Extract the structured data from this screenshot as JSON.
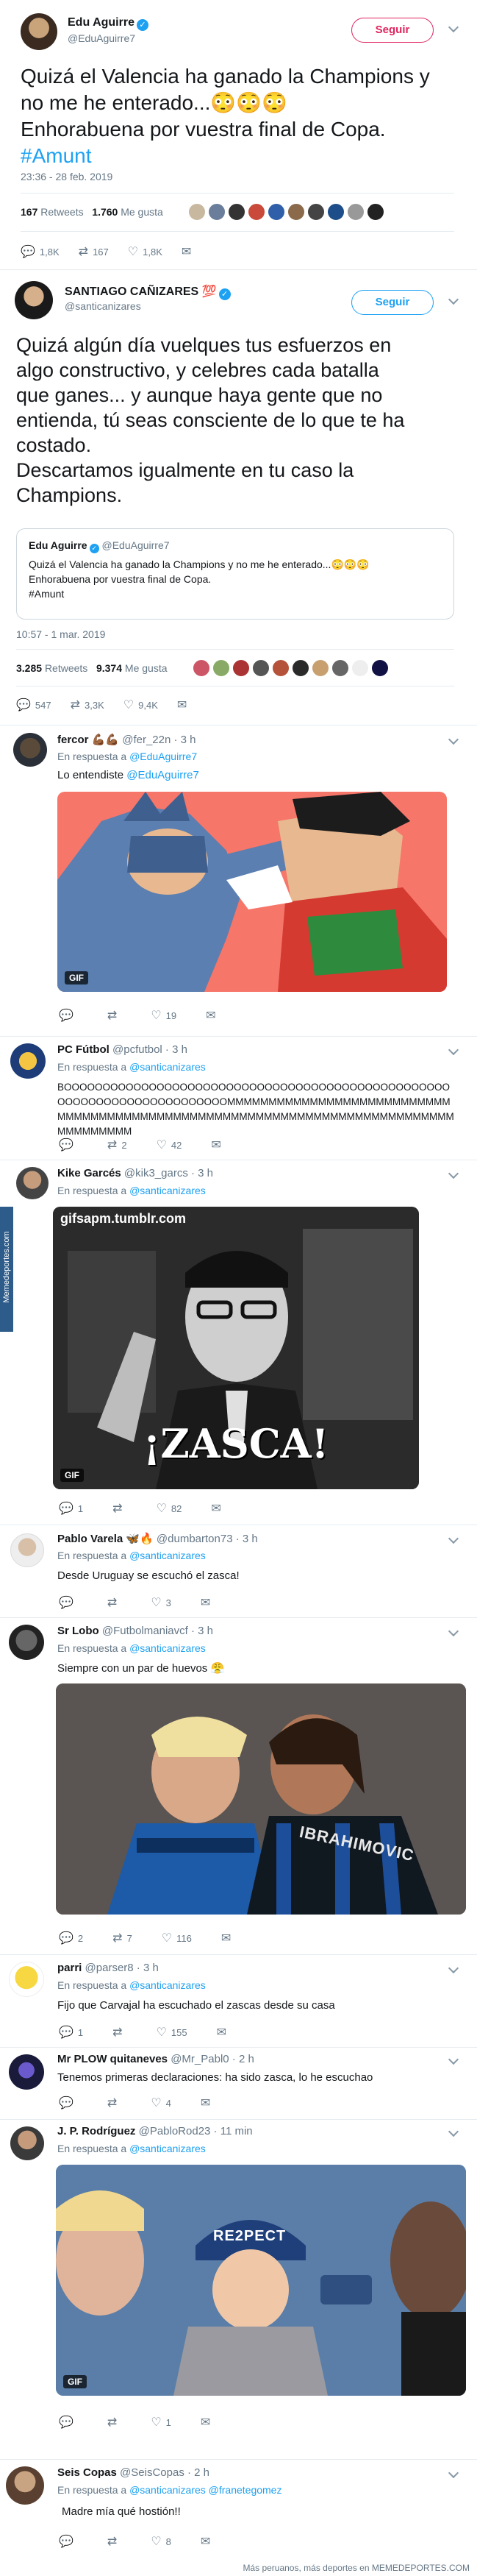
{
  "tweet1": {
    "name": "Edu Aguirre",
    "handle": "@EduAguirre7",
    "follow_label": "Seguir",
    "text_line1": "Quizá el Valencia ha ganado la Champions y",
    "text_line2": "no me he enterado...😳😳😳",
    "text_line3": "Enhorabuena por vuestra final de Copa.",
    "hashtag": "#Amunt",
    "timestamp": "23:36 - 28 feb. 2019",
    "retweets_count": "167",
    "retweets_label": "Retweets",
    "likes_count": "1.760",
    "likes_label": "Me gusta",
    "replies": "1,8K",
    "rts": "167",
    "likes": "1,8K"
  },
  "tweet2": {
    "name": "SANTIAGO CAÑIZARES 💯",
    "handle": "@santicanizares",
    "follow_label": "Seguir",
    "text_line1": "Quizá algún día vuelques tus esfuerzos en",
    "text_line2": "algo constructivo, y celebres cada batalla",
    "text_line3": "que ganes...  y aunque haya gente que no",
    "text_line4": "entienda, tú seas consciente de lo que te ha",
    "text_line5": "costado.",
    "text_line6": "Descartamos igualmente en tu caso la",
    "text_line7": "Champions.",
    "quote_name": "Edu Aguirre",
    "quote_handle": "@EduAguirre7",
    "quote_line1": "Quizá el Valencia ha ganado la Champions y no me he enterado...😳😳😳",
    "quote_line2": "Enhorabuena por vuestra final de Copa.",
    "quote_line3": "#Amunt",
    "timestamp": "10:57 - 1 mar. 2019",
    "retweets_count": "3.285",
    "retweets_label": "Retweets",
    "likes_count": "9.374",
    "likes_label": "Me gusta",
    "replies": "547",
    "rts": "3,3K",
    "likes": "9,4K"
  },
  "replies": [
    {
      "name": "fercor 💪🏾💪🏾",
      "handle": "@fer_22n · 3 h",
      "reply_label": "En respuesta a",
      "reply_to": "@EduAguirre7",
      "text": "Lo entendiste",
      "mention": "@EduAguirre7",
      "r": "",
      "rt": "",
      "l": "19",
      "gif": "GIF"
    },
    {
      "name": "PC Fútbol",
      "handle": "@pcfutbol · 3 h",
      "reply_label": "En respuesta a",
      "reply_to": "@santicanizares",
      "text": "BOOOOOOOOOOOOOOOOOOOOOOOOOOOOOOOOOOOOOOOOOOOOOOOOOOOOOOOOOOOOOOOOOOOOOOOOMMMMMMMMMMMMMMMMMMMMMMMMMMMMMMMMMMMMMMMMMMMMMMMMMMMMMMMMMMMMMMMMMMMMMMMMMMMMMMMMMMMM",
      "r": "",
      "rt": "2",
      "l": "42"
    },
    {
      "name": "Kike Garcés",
      "handle": "@kik3_garcs · 3 h",
      "reply_label": "En respuesta a",
      "reply_to": "@santicanizares",
      "text": "",
      "r": "1",
      "rt": "",
      "l": "82",
      "gif": "GIF",
      "watermark": "gifsapm.tumblr.com",
      "zasca": "¡ZASCA!"
    },
    {
      "name": "Pablo Varela 🦋🔥",
      "handle": "@dumbarton73 · 3 h",
      "reply_label": "En respuesta a",
      "reply_to": "@santicanizares",
      "text": "Desde Uruguay se escuchó el zasca!",
      "r": "",
      "rt": "",
      "l": "3"
    },
    {
      "name": "Sr Lobo",
      "handle": "@Futbolmaniavcf · 3 h",
      "reply_label": "En respuesta a",
      "reply_to": "@santicanizares",
      "text": "Siempre con un par de huevos 😤",
      "r": "2",
      "rt": "7",
      "l": "116",
      "jersey": "IBRAHIMOVIC"
    },
    {
      "name": "parri",
      "handle": "@parser8 · 3 h",
      "reply_label": "En respuesta a",
      "reply_to": "@santicanizares",
      "text": "Fijo que Carvajal ha escuchado el zascas desde su casa",
      "r": "1",
      "rt": "",
      "l": "155"
    },
    {
      "name": "Mr PLOW quitaneves",
      "handle": "@Mr_Pabl0 · 2 h",
      "text": "Tenemos primeras declaraciones: ha sido zasca, lo he escuchao",
      "r": "",
      "rt": "",
      "l": "4"
    },
    {
      "name": "J. P. Rodríguez",
      "handle": "@PabloRod23 · 11 min",
      "reply_label": "En respuesta a",
      "reply_to": "@santicanizares",
      "text": "",
      "r": "",
      "rt": "",
      "l": "1",
      "gif": "GIF",
      "cap": "RE2PECT"
    },
    {
      "name": "Seis Copas",
      "handle": "@SeisCopas · 2 h",
      "reply_label": "En respuesta a",
      "reply_to": "@santicanizares @franetegomez",
      "text": "Madre mía qué hostión!!",
      "r": "",
      "rt": "",
      "l": "8"
    }
  ],
  "side_watermark": "Memedeportes.com",
  "footer": "Más peruanos, más deportes en MEMEDEPORTES.COM"
}
